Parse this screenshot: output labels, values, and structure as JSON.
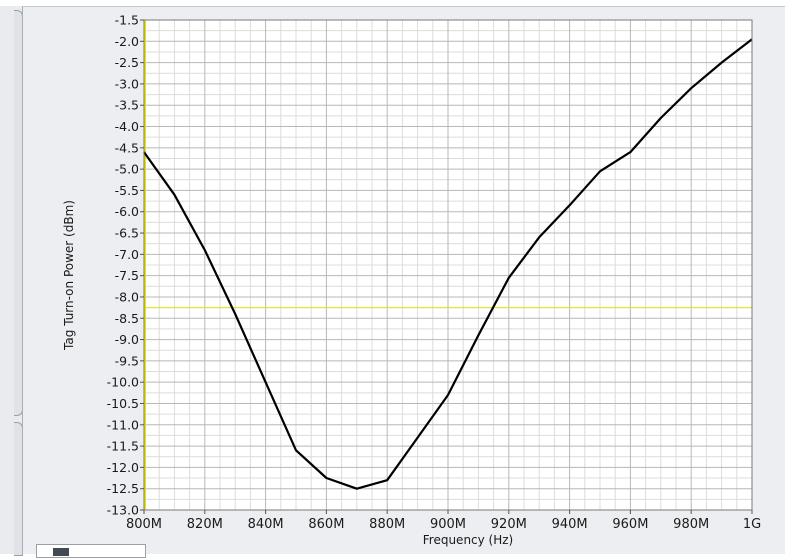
{
  "chart_data": {
    "type": "line",
    "title": "",
    "xlabel": "Frequency (Hz)",
    "ylabel": "Tag Turn-on Power (dBm)",
    "xlim": [
      800000000,
      1000000000
    ],
    "ylim": [
      -13.0,
      -1.5
    ],
    "grid": true,
    "x_ticks": [
      {
        "value": 800000000,
        "label": "800M"
      },
      {
        "value": 820000000,
        "label": "820M"
      },
      {
        "value": 840000000,
        "label": "840M"
      },
      {
        "value": 860000000,
        "label": "860M"
      },
      {
        "value": 880000000,
        "label": "880M"
      },
      {
        "value": 900000000,
        "label": "900M"
      },
      {
        "value": 920000000,
        "label": "920M"
      },
      {
        "value": 940000000,
        "label": "940M"
      },
      {
        "value": 960000000,
        "label": "960M"
      },
      {
        "value": 980000000,
        "label": "980M"
      },
      {
        "value": 1000000000,
        "label": "1G"
      }
    ],
    "y_ticks": [
      {
        "value": -1.5,
        "label": "-1.5"
      },
      {
        "value": -2.0,
        "label": "-2.0"
      },
      {
        "value": -2.5,
        "label": "-2.5"
      },
      {
        "value": -3.0,
        "label": "-3.0"
      },
      {
        "value": -3.5,
        "label": "-3.5"
      },
      {
        "value": -4.0,
        "label": "-4.0"
      },
      {
        "value": -4.5,
        "label": "-4.5"
      },
      {
        "value": -5.0,
        "label": "-5.0"
      },
      {
        "value": -5.5,
        "label": "-5.5"
      },
      {
        "value": -6.0,
        "label": "-6.0"
      },
      {
        "value": -6.5,
        "label": "-6.5"
      },
      {
        "value": -7.0,
        "label": "-7.0"
      },
      {
        "value": -7.5,
        "label": "-7.5"
      },
      {
        "value": -8.0,
        "label": "-8.0"
      },
      {
        "value": -8.5,
        "label": "-8.5"
      },
      {
        "value": -9.0,
        "label": "-9.0"
      },
      {
        "value": -9.5,
        "label": "-9.5"
      },
      {
        "value": -10.0,
        "label": "-10.0"
      },
      {
        "value": -10.5,
        "label": "-10.5"
      },
      {
        "value": -11.0,
        "label": "-11.0"
      },
      {
        "value": -11.5,
        "label": "-11.5"
      },
      {
        "value": -12.0,
        "label": "-12.0"
      },
      {
        "value": -12.5,
        "label": "-12.5"
      },
      {
        "value": -13.0,
        "label": "-13.0"
      }
    ],
    "series": [
      {
        "color": "#000000",
        "x": [
          800000000,
          810000000,
          820000000,
          830000000,
          840000000,
          850000000,
          860000000,
          870000000,
          880000000,
          890000000,
          900000000,
          910000000,
          920000000,
          930000000,
          940000000,
          950000000,
          960000000,
          970000000,
          980000000,
          990000000,
          1000000000
        ],
        "y": [
          -4.6,
          -5.6,
          -6.9,
          -8.4,
          -10.0,
          -11.6,
          -12.25,
          -12.5,
          -12.3,
          -11.3,
          -10.3,
          -8.9,
          -7.55,
          -6.6,
          -5.85,
          -5.05,
          -4.6,
          -3.8,
          -3.1,
          -2.5,
          -1.95
        ]
      }
    ],
    "cursors": [
      {
        "axis": "x",
        "value": 800000000,
        "color": "#e6e600"
      },
      {
        "axis": "y",
        "value": -8.25,
        "color": "#e6e600"
      }
    ],
    "colors": {
      "plot_background": "#ffffff",
      "grid_major": "#b8b8b8",
      "grid_minor": "#dcdcdc",
      "frame_background": "#eceef1"
    }
  }
}
